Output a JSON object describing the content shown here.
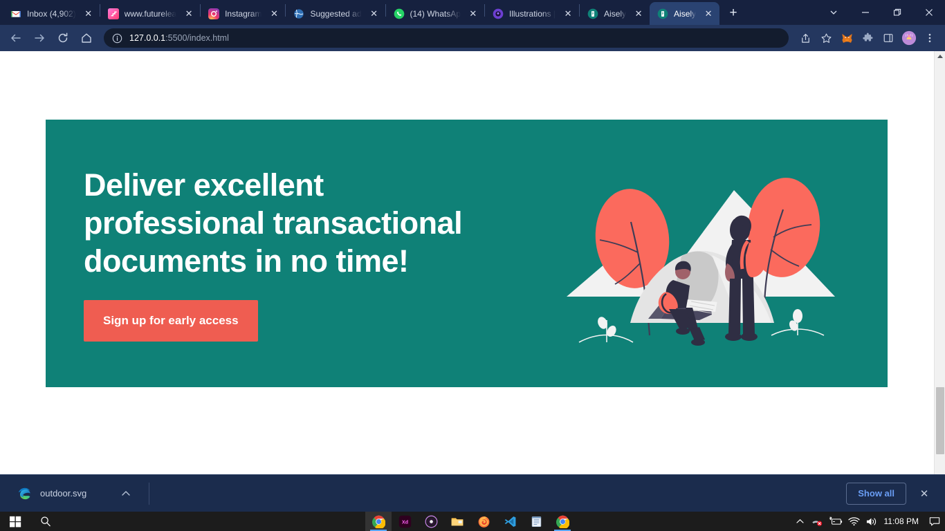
{
  "browser": {
    "tabs": [
      {
        "title": "Inbox (4,902)",
        "favicon": "gmail-icon",
        "active": false
      },
      {
        "title": "www.futurelea",
        "favicon": "pink-gradient-icon",
        "active": false
      },
      {
        "title": "Instagram",
        "favicon": "instagram-icon",
        "active": false
      },
      {
        "title": "Suggested ad",
        "favicon": "globe-icon",
        "active": false
      },
      {
        "title": "(14) WhatsAp",
        "favicon": "whatsapp-icon",
        "active": false
      },
      {
        "title": "Illustrations |",
        "favicon": "purple-circle-icon",
        "active": false
      },
      {
        "title": "Aisely",
        "favicon": "aisely-icon",
        "active": false
      },
      {
        "title": "Aisely",
        "favicon": "aisely-icon",
        "active": true
      }
    ],
    "new_tab_label": "+",
    "tab_close_label": "✕",
    "window_controls": {
      "tab_search": "chevron-down-icon",
      "minimize": "minimize-icon",
      "maximize": "restore-icon",
      "close": "close-icon"
    },
    "toolbar": {
      "back": "back-arrow-icon",
      "forward": "forward-arrow-icon",
      "reload": "reload-icon",
      "home": "home-icon",
      "site_info": "info-circle-icon",
      "url_host": "127.0.0.1",
      "url_path": ":5500/index.html",
      "url_full": "127.0.0.1:5500/index.html",
      "right_icons": [
        "share-icon",
        "bookmark-star-icon",
        "metamask-extension-icon",
        "extensions-puzzle-icon",
        "sidebar-icon",
        "profile-avatar",
        "kebab-menu-icon"
      ]
    }
  },
  "page": {
    "hero": {
      "heading": "Deliver excellent\nprofessional transactional\ndocuments in no time!",
      "cta_label": "Sign up for early access",
      "background_color": "#0f8177",
      "cta_color": "#ef5d51",
      "illustration_name": "camping-tent-illustration",
      "illustration_colors": {
        "tree": "#fb6a5d",
        "mountain": "#f1f1f1",
        "tent": "#e6e6e6",
        "figure": "#2f2e43",
        "skin": "#a0616a",
        "backpack": "#fb6a5d"
      }
    }
  },
  "scrollbar": {
    "up_arrow": "scroll-up-arrow",
    "down_arrow": "scroll-down-arrow"
  },
  "download_bar": {
    "file_name": "outdoor.svg",
    "file_icon": "edge-browser-icon",
    "expand_icon": "chevron-up-icon",
    "show_all_label": "Show all",
    "close_label": "✕"
  },
  "taskbar": {
    "start_label": "windows-start-icon",
    "search_label": "search-icon",
    "apps": [
      {
        "name": "chrome-taskbar-icon",
        "label": "Chrome"
      },
      {
        "name": "adobe-xd-taskbar-icon",
        "label": "Xd"
      },
      {
        "name": "recorder-taskbar-icon",
        "label": "Recorder"
      },
      {
        "name": "file-explorer-taskbar-icon",
        "label": "File Explorer"
      },
      {
        "name": "firefox-taskbar-icon",
        "label": "Firefox"
      },
      {
        "name": "vscode-taskbar-icon",
        "label": "Visual Studio Code"
      },
      {
        "name": "notepad-taskbar-icon",
        "label": "Notepad"
      },
      {
        "name": "chrome2-taskbar-icon",
        "label": "Chrome"
      }
    ],
    "tray": {
      "overflow": "chevron-up-icon",
      "device_disabled": "device-disabled-icon",
      "battery": "battery-charging-icon",
      "wifi": "wifi-icon",
      "volume": "volume-icon",
      "clock": "11:08 PM",
      "notifications": "notification-icon"
    }
  }
}
